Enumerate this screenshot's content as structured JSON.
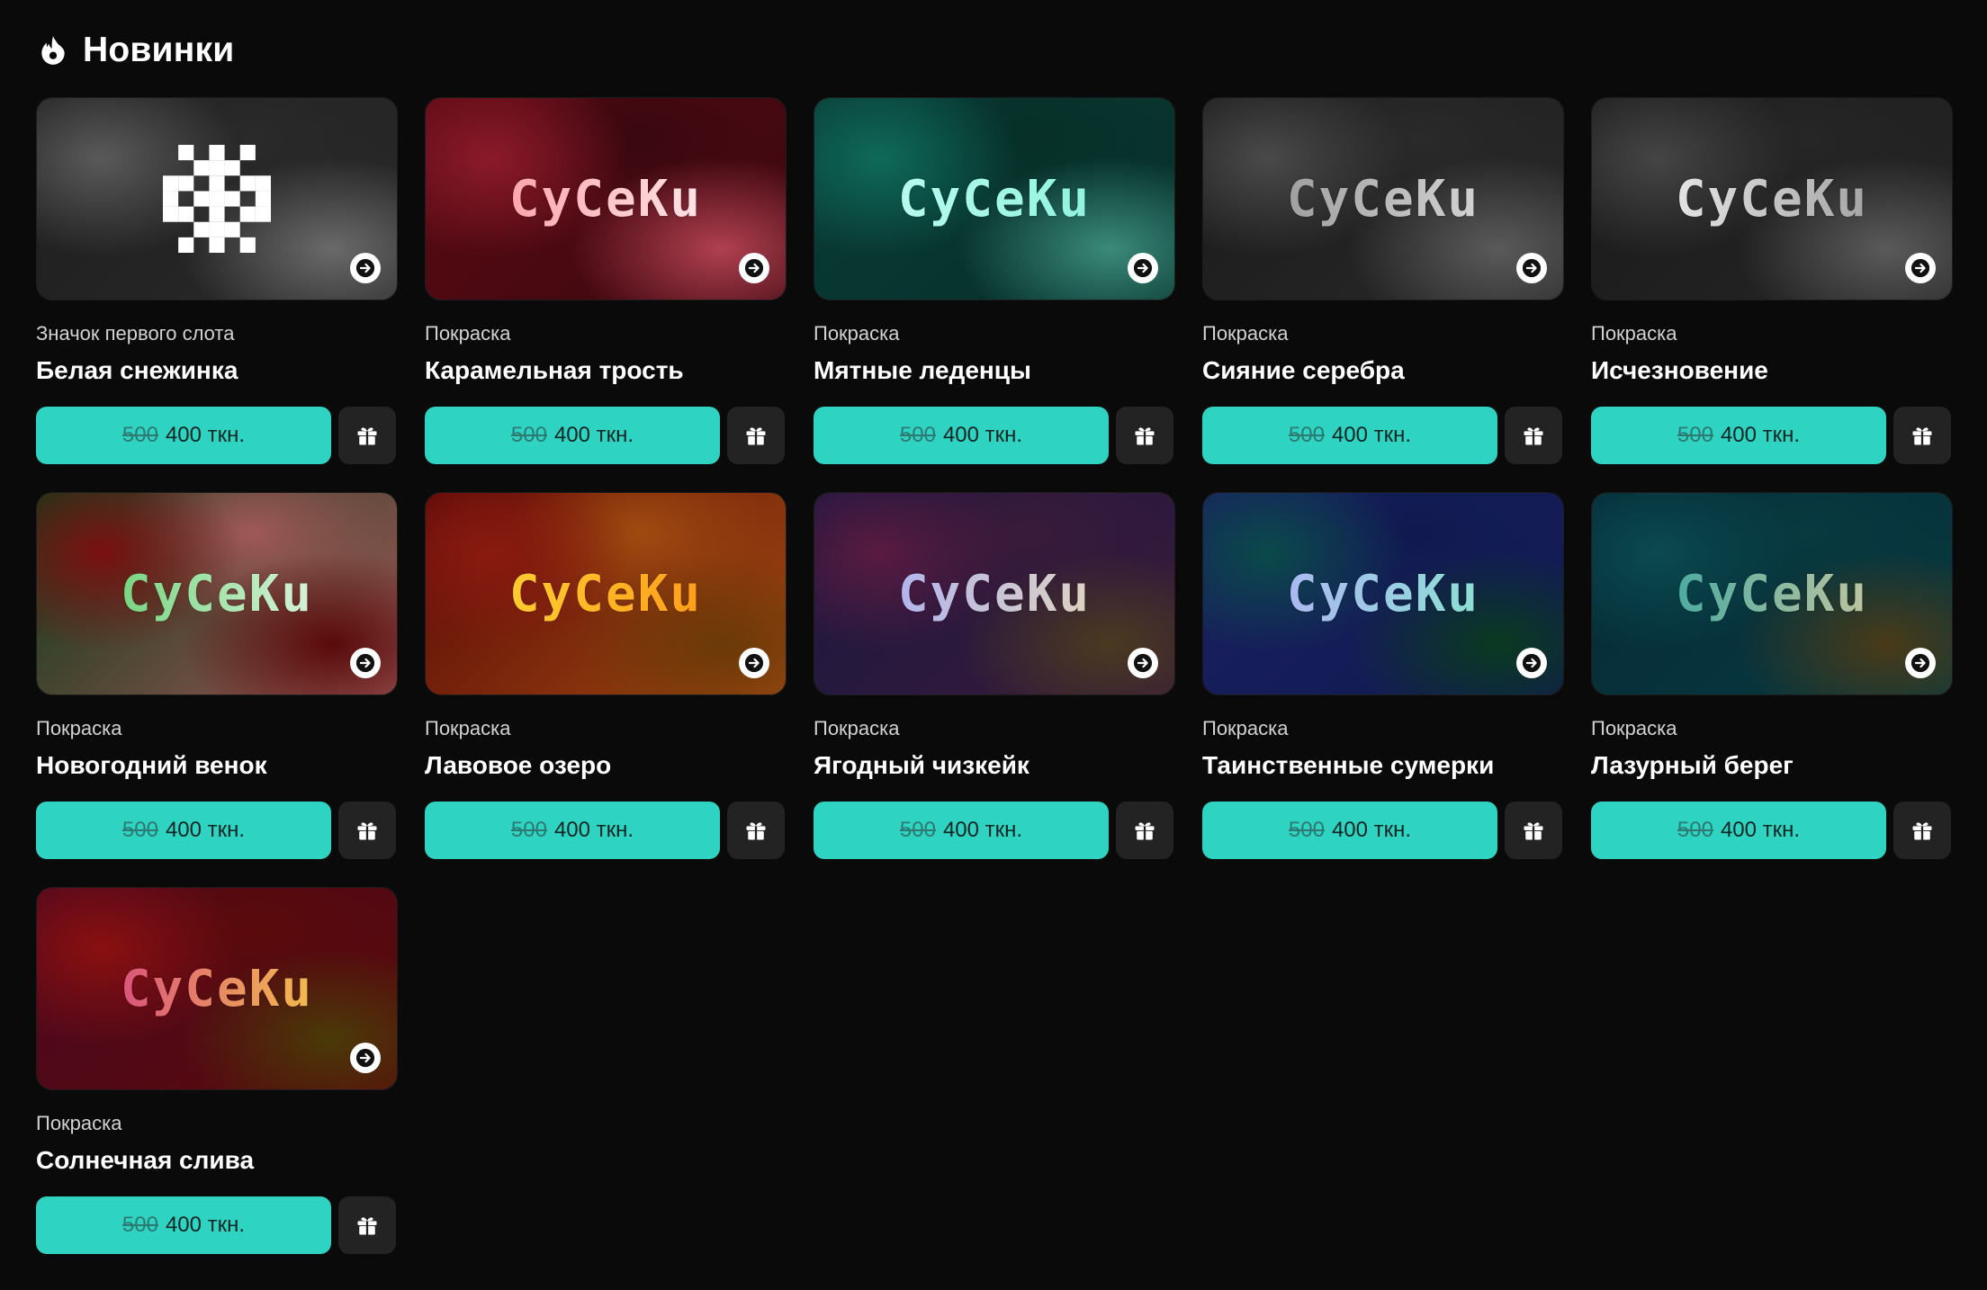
{
  "section": {
    "title": "Новинки",
    "icon": "flame-icon"
  },
  "brand_text": "CyCeKu",
  "currency": "ткн.",
  "items": [
    {
      "category": "Значок первого слота",
      "name": "Белая снежинка",
      "old_price": "500",
      "new_price": "400",
      "kind": "snowflake",
      "bg": [
        "#1e1e1e",
        "#5a5a5a",
        "#2a2a2a",
        "#6a6a6a"
      ],
      "text": [
        "#ffffff",
        "#ffffff"
      ]
    },
    {
      "category": "Покраска",
      "name": "Карамельная трость",
      "old_price": "500",
      "new_price": "400",
      "kind": "brand",
      "bg": [
        "#5a0a12",
        "#8b1a2a",
        "#3a0810",
        "#b04050"
      ],
      "text": [
        "#ff8a94",
        "#ffffff"
      ]
    },
    {
      "category": "Покраска",
      "name": "Мятные леденцы",
      "old_price": "500",
      "new_price": "400",
      "kind": "brand",
      "bg": [
        "#0a3a36",
        "#0e6a5a",
        "#063028",
        "#3a8a7a"
      ],
      "text": [
        "#c8fff2",
        "#7ff0d8"
      ]
    },
    {
      "category": "Покраска",
      "name": "Сияние серебра",
      "old_price": "500",
      "new_price": "400",
      "kind": "brand",
      "bg": [
        "#1a1a1a",
        "#4a4a4a",
        "#2a2a2a",
        "#5a5a5a"
      ],
      "text": [
        "#8a8a8a",
        "#e8e8e8"
      ]
    },
    {
      "category": "Покраска",
      "name": "Исчезновение",
      "old_price": "500",
      "new_price": "400",
      "kind": "brand",
      "bg": [
        "#1a1a1a",
        "#454545",
        "#262626",
        "#5a5a5a"
      ],
      "text": [
        "#ffffff",
        "#8a8a8a"
      ]
    },
    {
      "category": "Покраска",
      "name": "Новогодний венок",
      "old_price": "500",
      "new_price": "400",
      "kind": "brand",
      "bg": [
        "#0f3a18",
        "#7a1010",
        "#a05858",
        "#5a0a0a"
      ],
      "text": [
        "#4ec85a",
        "#ffffff"
      ]
    },
    {
      "category": "Покраска",
      "name": "Лавовое озеро",
      "old_price": "500",
      "new_price": "400",
      "kind": "brand",
      "bg": [
        "#5a0808",
        "#8a1a10",
        "#a04a10",
        "#6a3a08"
      ],
      "text": [
        "#ffe038",
        "#ff8a10"
      ]
    },
    {
      "category": "Покраска",
      "name": "Ягодный чизкейк",
      "old_price": "500",
      "new_price": "400",
      "kind": "brand",
      "bg": [
        "#1a1840",
        "#5a1a40",
        "#3a1a3a",
        "#4a3a20"
      ],
      "text": [
        "#a0a8ff",
        "#f0e0b0"
      ]
    },
    {
      "category": "Покраска",
      "name": "Таинственные сумерки",
      "old_price": "500",
      "new_price": "400",
      "kind": "brand",
      "bg": [
        "#1a2060",
        "#0a4a4a",
        "#101a50",
        "#0a3a20"
      ],
      "text": [
        "#b8a8ff",
        "#7ff0c8"
      ]
    },
    {
      "category": "Покраска",
      "name": "Лазурный берег",
      "old_price": "500",
      "new_price": "400",
      "kind": "brand",
      "bg": [
        "#062a36",
        "#0a4a50",
        "#083a40",
        "#4a3a18"
      ],
      "text": [
        "#1aa0a0",
        "#f0d0a0"
      ]
    },
    {
      "category": "Покраска",
      "name": "Солнечная слива",
      "old_price": "500",
      "new_price": "400",
      "kind": "brand",
      "bg": [
        "#4a0820",
        "#8a1010",
        "#5a0a0a",
        "#4a3a08"
      ],
      "text": [
        "#d02890",
        "#ffe838"
      ]
    }
  ]
}
